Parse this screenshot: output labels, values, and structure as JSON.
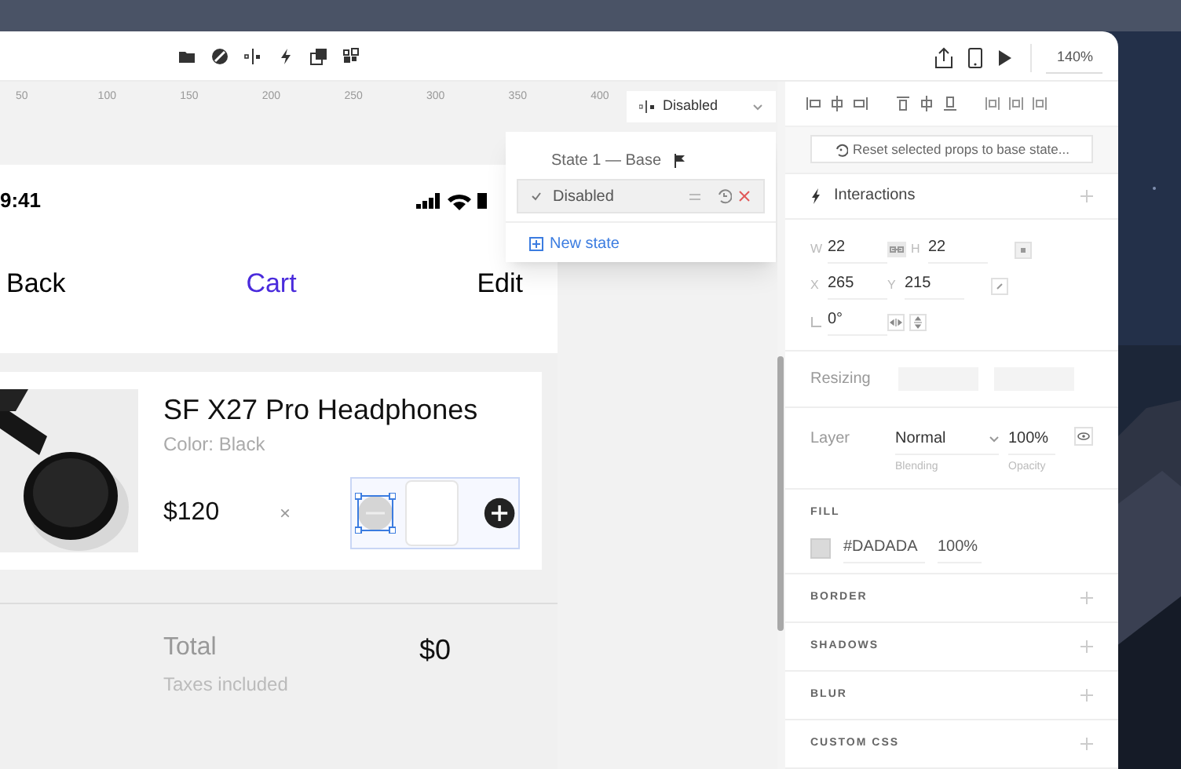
{
  "toolbar": {
    "zoom": "140%"
  },
  "ruler": {
    "labels": [
      "50",
      "100",
      "150",
      "200",
      "250",
      "300",
      "350",
      "400"
    ]
  },
  "state_picker": {
    "label": "Disabled"
  },
  "states_menu": {
    "items": [
      {
        "label": "State 1 — Base",
        "kind": "base",
        "selected": false
      },
      {
        "label": "Disabled",
        "kind": "state",
        "selected": true
      }
    ],
    "new_state": "New state"
  },
  "phone": {
    "time": "9:41",
    "back": "Back",
    "title": "Cart",
    "edit": "Edit",
    "item": {
      "name": "SF X27 Pro Headphones",
      "variant": "Color: Black",
      "price": "$120",
      "times": "×"
    },
    "total": {
      "label": "Total",
      "note": "Taxes included",
      "amount": "$0"
    }
  },
  "inspector": {
    "reset_button": "Reset selected props to base state...",
    "interactions": "Interactions",
    "geometry": [
      {
        "label": "W",
        "value": "22"
      },
      {
        "label": "H",
        "value": "22"
      },
      {
        "label": "X",
        "value": "265"
      },
      {
        "label": "Y",
        "value": "215"
      }
    ],
    "rotation": "0°",
    "resizing": "Resizing",
    "layer": {
      "label": "Layer",
      "blending": "Normal",
      "blending_caption": "Blending",
      "opacity": "100%",
      "opacity_caption": "Opacity"
    },
    "fill": {
      "title": "FILL",
      "hex": "#DADADA",
      "opacity": "100%"
    },
    "sections": [
      "BORDER",
      "SHADOWS",
      "BLUR",
      "CUSTOM CSS"
    ]
  }
}
